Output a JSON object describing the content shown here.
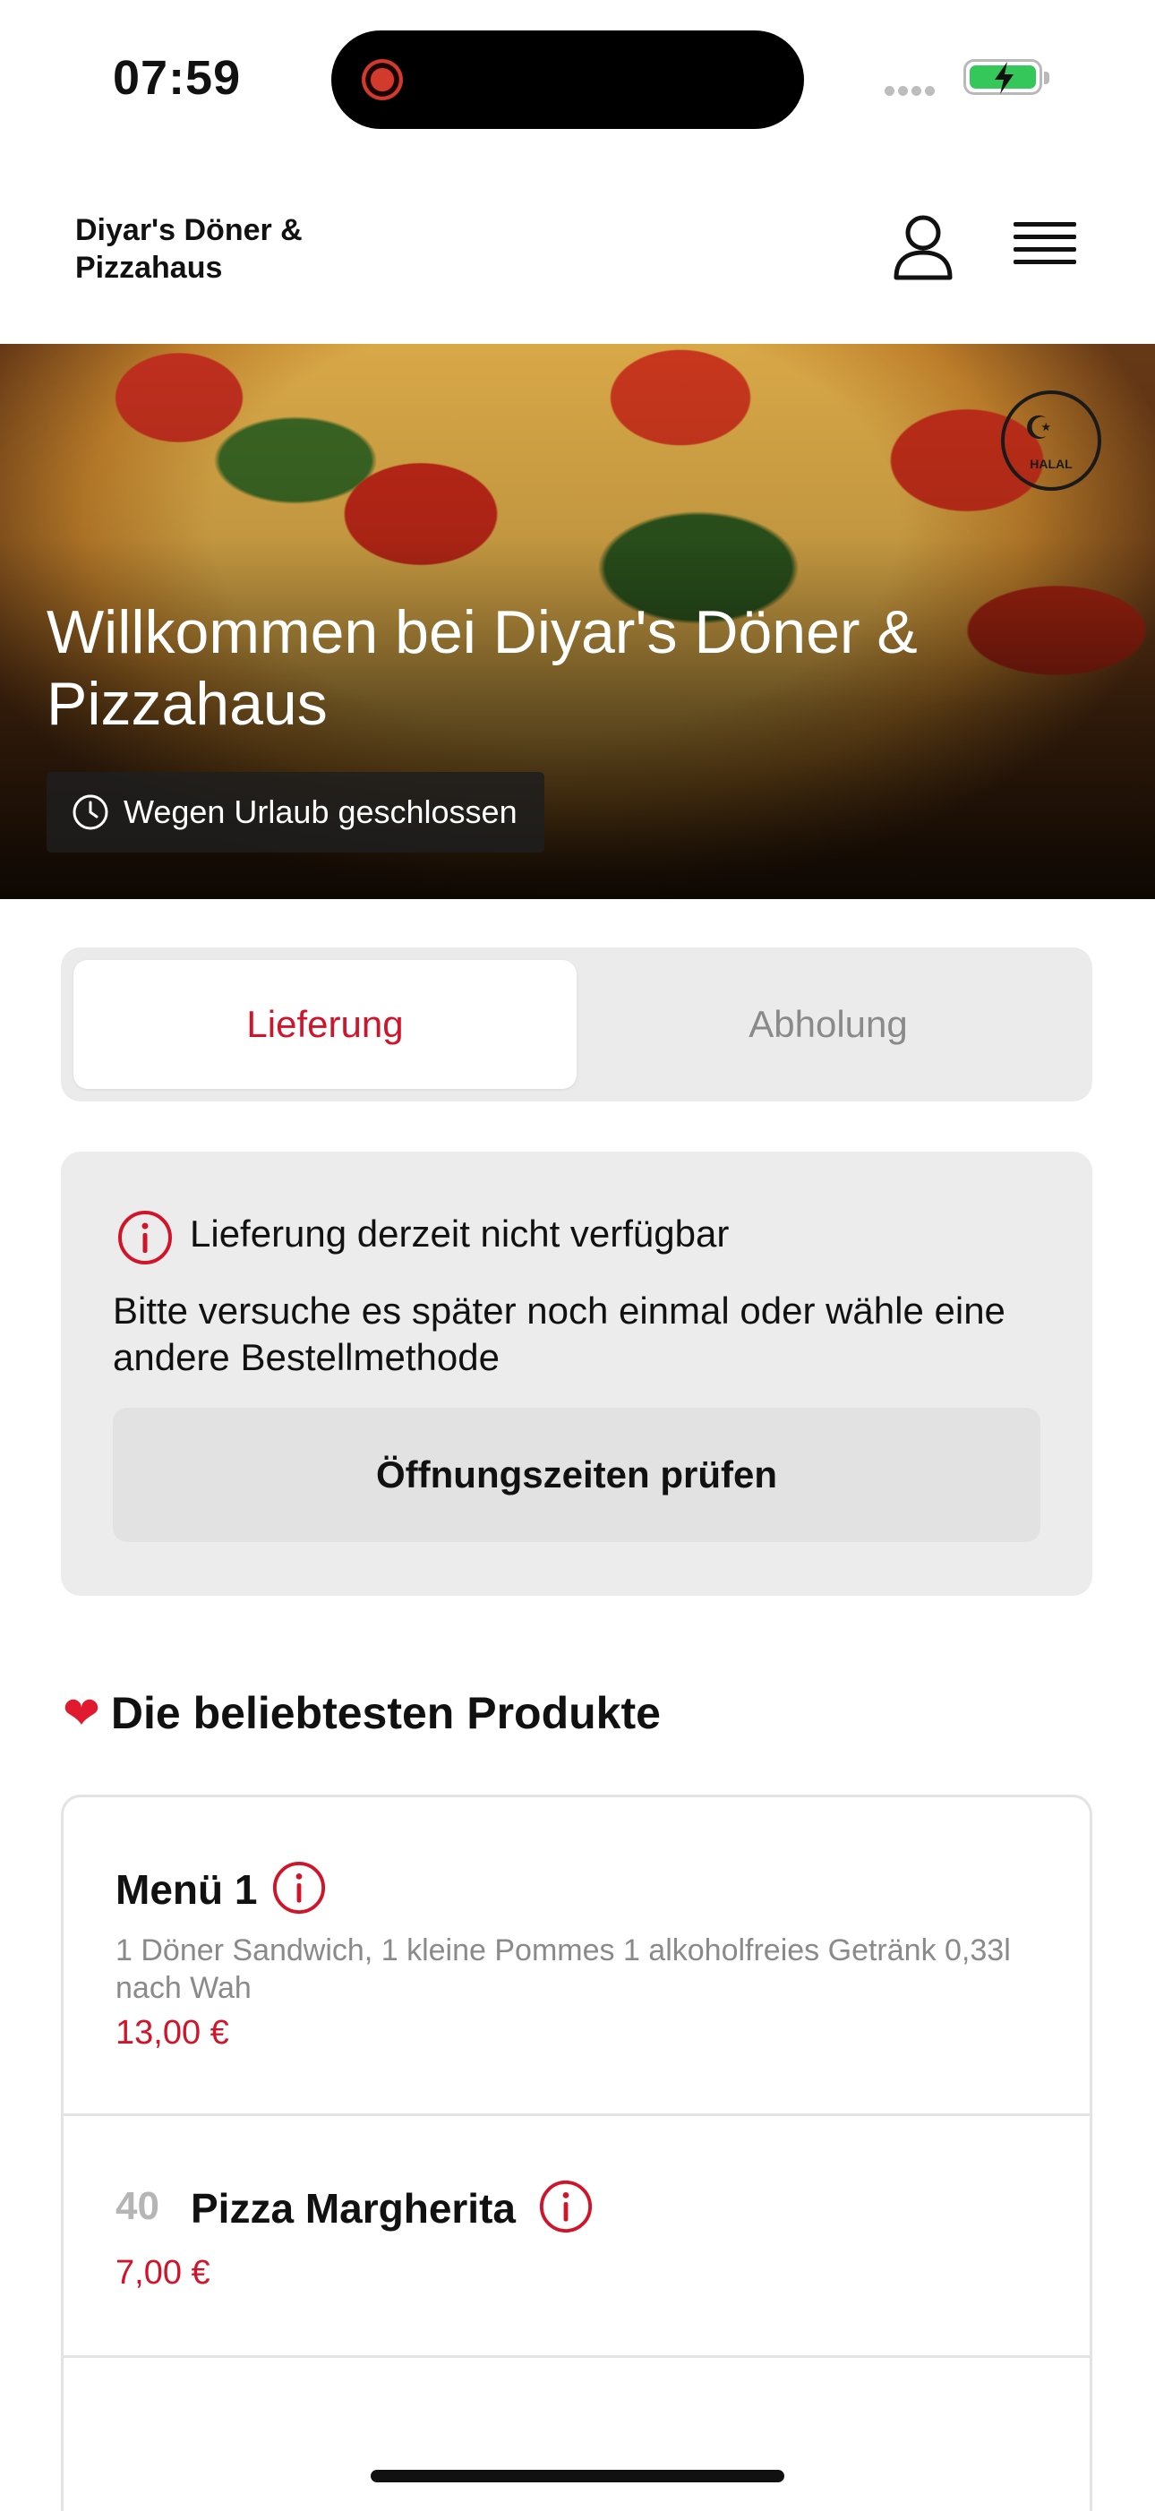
{
  "status_bar": {
    "time": "07:59"
  },
  "header": {
    "brand": "Diyar's Döner & Pizzahaus"
  },
  "hero": {
    "title": "Willkommen bei Diyar's Döner & Pizzahaus",
    "status": "Wegen Urlaub geschlossen",
    "badge_text": "HALAL"
  },
  "tabs": [
    {
      "label": "Lieferung",
      "active": true
    },
    {
      "label": "Abholung",
      "active": false
    }
  ],
  "notice": {
    "title": "Lieferung derzeit nicht verfügbar",
    "text": "Bitte versuche es später noch einmal oder wähle eine andere Bestellmethode",
    "button": "Öffnungszeiten prüfen"
  },
  "popular": {
    "heading": "Die beliebtesten Produkte",
    "heart": "❤",
    "products": [
      {
        "number": "",
        "name": "Menü 1",
        "description": "1 Döner Sandwich, 1 kleine Pommes 1 alkoholfreies Getränk 0,33l nach Wah",
        "price": "13,00 €"
      },
      {
        "number": "40",
        "name": "Pizza Margherita",
        "description": "",
        "price": "7,00 €"
      }
    ]
  },
  "colors": {
    "accent": "#d0152a",
    "battery": "#35c759"
  }
}
